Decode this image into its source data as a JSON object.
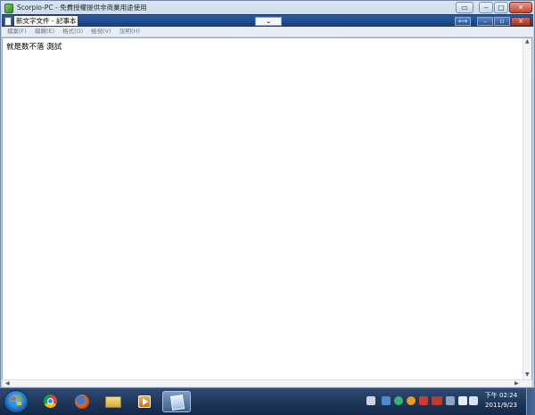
{
  "outer_window": {
    "title": "Scorpio-PC - 免費授權提供非商業用途使用"
  },
  "notepad": {
    "title": "新文字文件 - 記事本",
    "menu": [
      "檔案(F)",
      "編輯(E)",
      "格式(O)",
      "檢視(V)",
      "說明(H)"
    ],
    "content": "就是数不落 測試"
  },
  "taskbar": {
    "pinned": [
      "chrome-icon",
      "firefox-icon",
      "folder-icon",
      "media-player-icon",
      "notepad-icon"
    ],
    "clock_time": "下午 02:24",
    "clock_date": "2011/9/23"
  },
  "colors": {
    "accent": "#1c3d74",
    "taskbar": "#1c3557"
  }
}
